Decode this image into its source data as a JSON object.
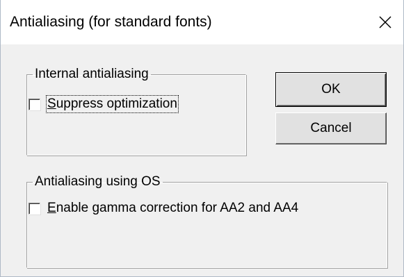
{
  "window": {
    "title": "Antialiasing (for standard fonts)",
    "close_icon": "close-icon"
  },
  "groups": {
    "internal": {
      "legend": "Internal antialiasing",
      "checkbox": {
        "label_mnemonic": "S",
        "label_rest": "uppress optimization",
        "checked": false
      }
    },
    "os": {
      "legend": "Antialiasing using OS",
      "checkbox": {
        "label_mnemonic": "E",
        "label_rest": "nable gamma correction for AA2 and AA4",
        "checked": false
      }
    }
  },
  "buttons": {
    "ok_label": "OK",
    "cancel_label": "Cancel"
  },
  "colors": {
    "dialog_bg": "#f0f0f0",
    "titlebar_bg": "#ffffff",
    "button_face": "#e1e1e1"
  }
}
